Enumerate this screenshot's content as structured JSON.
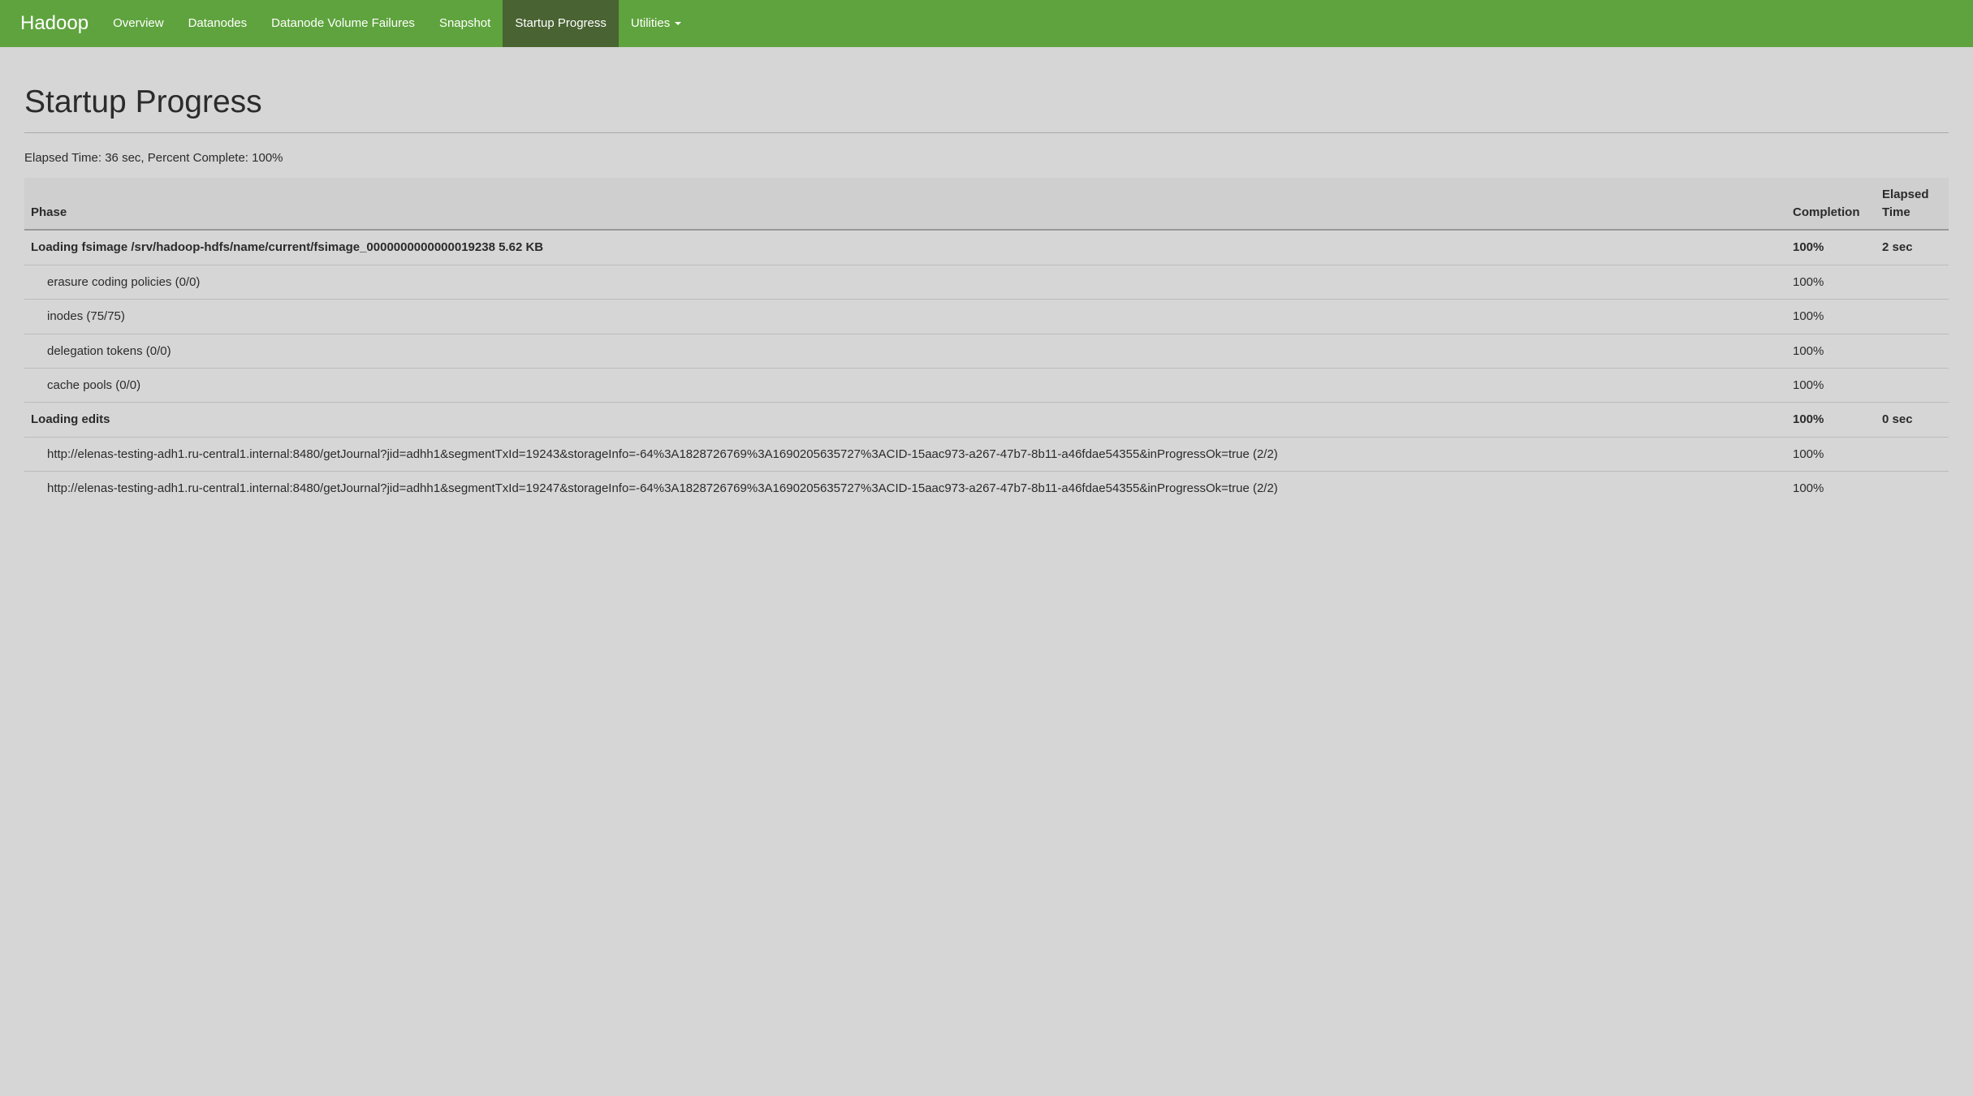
{
  "brand": "Hadoop",
  "nav": {
    "items": [
      {
        "label": "Overview",
        "active": false
      },
      {
        "label": "Datanodes",
        "active": false
      },
      {
        "label": "Datanode Volume Failures",
        "active": false
      },
      {
        "label": "Snapshot",
        "active": false
      },
      {
        "label": "Startup Progress",
        "active": true
      },
      {
        "label": "Utilities",
        "active": false,
        "dropdown": true
      }
    ]
  },
  "page": {
    "title": "Startup Progress",
    "summary": "Elapsed Time: 36 sec, Percent Complete: 100%"
  },
  "table": {
    "headers": {
      "phase": "Phase",
      "completion": "Completion",
      "elapsed": "Elapsed Time"
    },
    "rows": [
      {
        "type": "phase",
        "phase": "Loading fsimage /srv/hadoop-hdfs/name/current/fsimage_0000000000000019238 5.62 KB",
        "completion": "100%",
        "elapsed": "2 sec"
      },
      {
        "type": "sub",
        "phase": "erasure coding policies (0/0)",
        "completion": "100%",
        "elapsed": ""
      },
      {
        "type": "sub",
        "phase": "inodes (75/75)",
        "completion": "100%",
        "elapsed": ""
      },
      {
        "type": "sub",
        "phase": "delegation tokens (0/0)",
        "completion": "100%",
        "elapsed": ""
      },
      {
        "type": "sub",
        "phase": "cache pools (0/0)",
        "completion": "100%",
        "elapsed": ""
      },
      {
        "type": "phase",
        "phase": "Loading edits",
        "completion": "100%",
        "elapsed": "0 sec"
      },
      {
        "type": "sub",
        "phase": "http://elenas-testing-adh1.ru-central1.internal:8480/getJournal?jid=adhh1&segmentTxId=19243&storageInfo=-64%3A1828726769%3A1690205635727%3ACID-15aac973-a267-47b7-8b11-a46fdae54355&inProgressOk=true (2/2)",
        "completion": "100%",
        "elapsed": ""
      },
      {
        "type": "sub",
        "phase": "http://elenas-testing-adh1.ru-central1.internal:8480/getJournal?jid=adhh1&segmentTxId=19247&storageInfo=-64%3A1828726769%3A1690205635727%3ACID-15aac973-a267-47b7-8b11-a46fdae54355&inProgressOk=true (2/2)",
        "completion": "100%",
        "elapsed": ""
      }
    ]
  }
}
